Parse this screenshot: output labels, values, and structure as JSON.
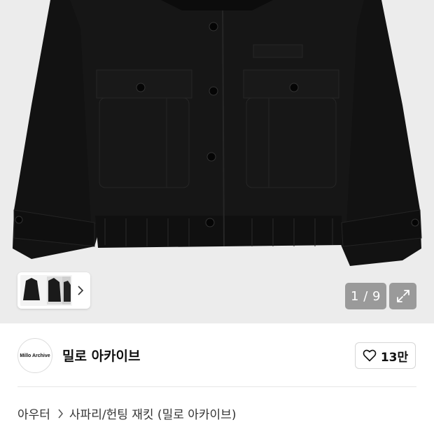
{
  "gallery": {
    "current_page": "1",
    "total_pages": "9",
    "counter_text": "1 / 9",
    "background_color": "#ececec",
    "product_color": "#141414"
  },
  "icons": {
    "thumb_next": "chevron-right-icon",
    "expand": "expand-icon",
    "like": "heart-outline-icon",
    "breadcrumb_sep": "chevron-right-icon"
  },
  "brand": {
    "logo_text": "Millo Archive",
    "name": "밀로 아카이브",
    "like_count": "13만"
  },
  "breadcrumb": {
    "items": [
      "아우터",
      "사파리/헌팅 재킷 (밀로 아카이브)"
    ]
  }
}
